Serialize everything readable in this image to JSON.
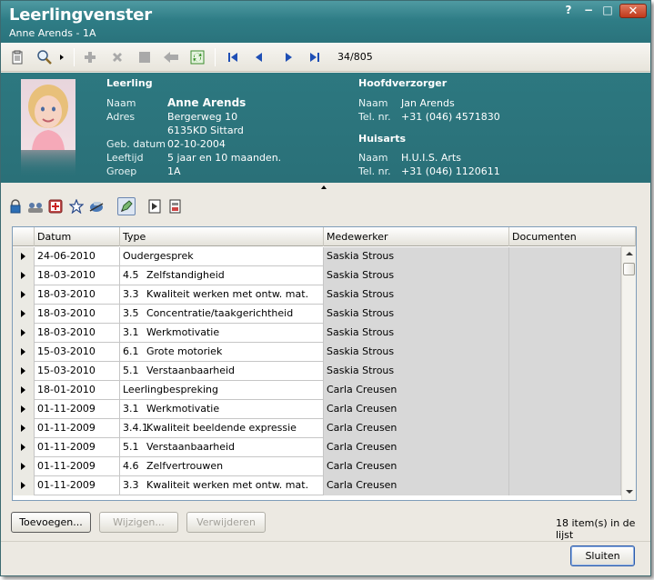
{
  "window": {
    "title": "Leerlingvenster",
    "subtitle": "Anne Arends - 1A",
    "help": "?",
    "min": "−",
    "max": "□",
    "close": "✕"
  },
  "toolbar": {
    "icons": [
      "clipboard-icon",
      "magnifier-icon",
      "dropdown-arrow-icon",
      "add-icon",
      "delete-icon",
      "stop-icon",
      "back-arrow-icon",
      "refresh-icon",
      "first-record-icon",
      "previous-record-icon",
      "next-record-icon",
      "last-record-icon"
    ],
    "record_counter": "34/805"
  },
  "student": {
    "section_title": "Leerling",
    "fields": [
      {
        "label": "Naam",
        "value": "Anne Arends"
      },
      {
        "label": "Adres",
        "value": "Bergerweg 10"
      },
      {
        "label": "",
        "value": "6135KD Sittard"
      },
      {
        "label": "Geb. datum",
        "value": "02-10-2004"
      },
      {
        "label": "Leeftijd",
        "value": "5 jaar en 10 maanden."
      },
      {
        "label": "Groep",
        "value": "1A"
      }
    ]
  },
  "guardian": {
    "section_title": "Hoofdverzorger",
    "fields": [
      {
        "label": "Naam",
        "value": "Jan Arends"
      },
      {
        "label": "Tel. nr.",
        "value": "+31 (046) 4571830"
      }
    ]
  },
  "doctor": {
    "section_title": "Huisarts",
    "fields": [
      {
        "label": "Naam",
        "value": "H.U.I.S. Arts"
      },
      {
        "label": "Tel. nr.",
        "value": "+31 (046) 1120611"
      }
    ]
  },
  "iconbar": {
    "icons": [
      "lock-icon",
      "group-icon",
      "medical-icon",
      "star-icon",
      "transport-icon",
      "notes-icon",
      "document-icon",
      "report-icon"
    ]
  },
  "grid": {
    "columns": [
      "Datum",
      "Type",
      "Medewerker",
      "Documenten"
    ],
    "rows": [
      {
        "datum": "24-06-2010",
        "num": "",
        "type": "Oudergesprek",
        "medewerker": "Saskia Strous",
        "documenten": ""
      },
      {
        "datum": "18-03-2010",
        "num": "4.5",
        "type": "Zelfstandigheid",
        "medewerker": "Saskia Strous",
        "documenten": ""
      },
      {
        "datum": "18-03-2010",
        "num": "3.3",
        "type": "Kwaliteit werken met ontw. mat.",
        "medewerker": "Saskia Strous",
        "documenten": ""
      },
      {
        "datum": "18-03-2010",
        "num": "3.5",
        "type": "Concentratie/taakgerichtheid",
        "medewerker": "Saskia Strous",
        "documenten": ""
      },
      {
        "datum": "18-03-2010",
        "num": "3.1",
        "type": "Werkmotivatie",
        "medewerker": "Saskia Strous",
        "documenten": ""
      },
      {
        "datum": "15-03-2010",
        "num": "6.1",
        "type": "Grote motoriek",
        "medewerker": "Saskia Strous",
        "documenten": ""
      },
      {
        "datum": "15-03-2010",
        "num": "5.1",
        "type": "Verstaanbaarheid",
        "medewerker": "Saskia Strous",
        "documenten": ""
      },
      {
        "datum": "18-01-2010",
        "num": "",
        "type": "Leerlingbespreking",
        "medewerker": "Carla Creusen",
        "documenten": ""
      },
      {
        "datum": "01-11-2009",
        "num": "3.1",
        "type": "Werkmotivatie",
        "medewerker": "Carla Creusen",
        "documenten": ""
      },
      {
        "datum": "01-11-2009",
        "num": "3.4.1",
        "type": "Kwaliteit beeldende expressie",
        "medewerker": "Carla Creusen",
        "documenten": ""
      },
      {
        "datum": "01-11-2009",
        "num": "5.1",
        "type": "Verstaanbaarheid",
        "medewerker": "Carla Creusen",
        "documenten": ""
      },
      {
        "datum": "01-11-2009",
        "num": "4.6",
        "type": "Zelfvertrouwen",
        "medewerker": "Carla Creusen",
        "documenten": ""
      },
      {
        "datum": "01-11-2009",
        "num": "3.3",
        "type": "Kwaliteit werken met ontw. mat.",
        "medewerker": "Carla Creusen",
        "documenten": ""
      }
    ]
  },
  "buttons": {
    "add": "Toevoegen...",
    "edit": "Wijzigen...",
    "delete": "Verwijderen",
    "close": "Sluiten"
  },
  "status": {
    "count": "18 item(s) in de lijst"
  }
}
